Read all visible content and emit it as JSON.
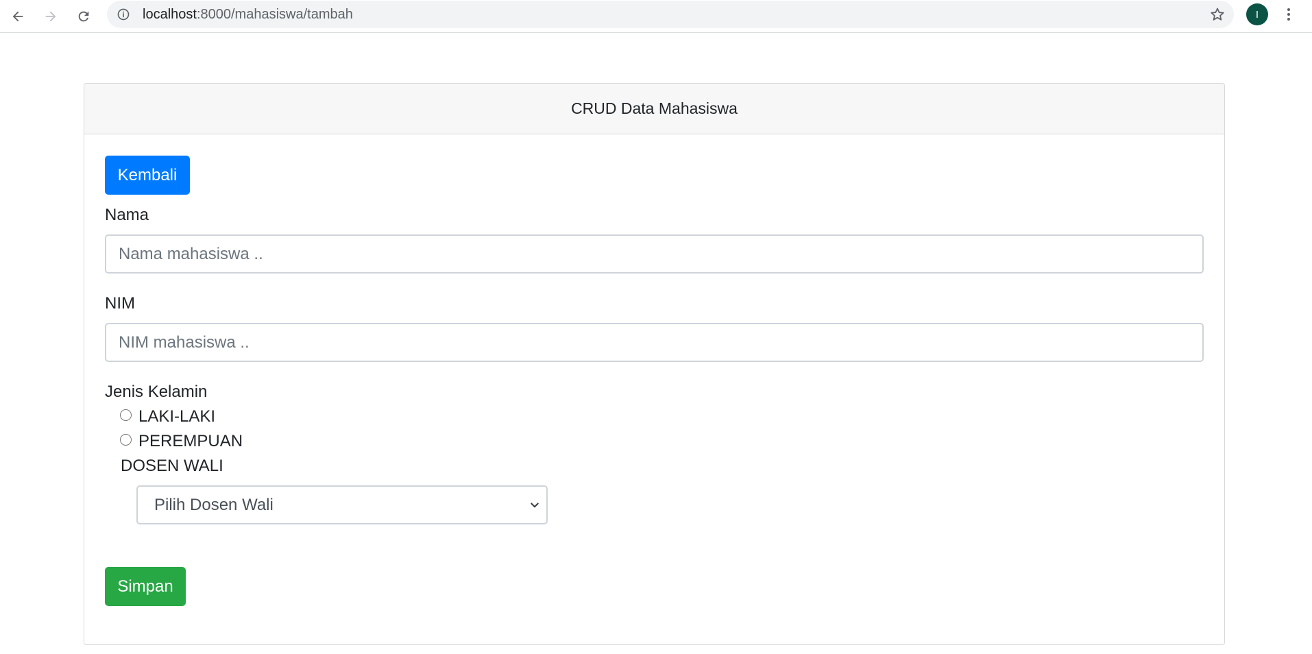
{
  "browser": {
    "url_host": "localhost",
    "url_path": ":8000/mahasiswa/tambah",
    "profile_initial": "I"
  },
  "card": {
    "title": "CRUD Data Mahasiswa"
  },
  "form": {
    "back_label": "Kembali",
    "nama": {
      "label": "Nama",
      "placeholder": "Nama mahasiswa ..",
      "value": ""
    },
    "nim": {
      "label": "NIM",
      "placeholder": "NIM mahasiswa ..",
      "value": ""
    },
    "gender": {
      "label": "Jenis Kelamin",
      "options": [
        "LAKI-LAKI",
        "PEREMPUAN"
      ]
    },
    "dosen_wali": {
      "label": "DOSEN WALI",
      "selected": "Pilih Dosen Wali"
    },
    "save_label": "Simpan"
  },
  "colors": {
    "primary": "#007bff",
    "success": "#28a745",
    "avatar": "#0b5345"
  },
  "icons": {
    "back": "arrow-left-icon",
    "forward": "arrow-right-icon",
    "reload": "reload-icon",
    "site_info": "info-icon",
    "bookmark": "star-icon",
    "menu": "kebab-menu-icon",
    "select": "chevron-down-icon"
  }
}
